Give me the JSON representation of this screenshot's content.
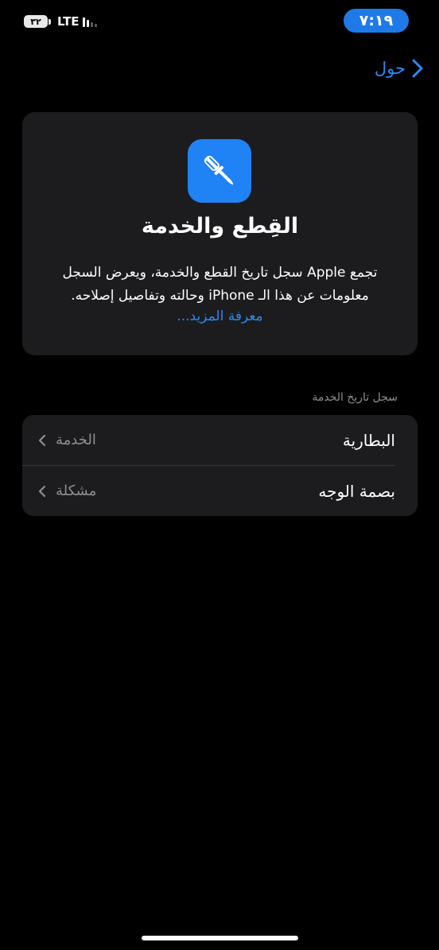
{
  "status_bar": {
    "time": "٧:١٩",
    "battery": "٣٢",
    "network": "LTE"
  },
  "nav": {
    "back_label": "حول",
    "back_icon": "chevron-right-icon"
  },
  "info_card": {
    "icon": "screwdriver-icon",
    "title": "القِطع والخدمة",
    "description_line1": "تجمع Apple سجل تاريخ القطع والخدمة، ويعرض السجل",
    "description_line2": "معلومات عن هذا الـ iPhone وحالته وتفاصيل إصلاحه.",
    "learn_more": "معرفة المزيد..."
  },
  "service_history": {
    "header": "سجل تاريخ الخدمة",
    "rows": [
      {
        "title": "البطارية",
        "detail": "الخدمة"
      },
      {
        "title": "بصمة الوجه",
        "detail": "مشكلة"
      }
    ]
  },
  "colors": {
    "accent": "#2b8af0",
    "card_bg": "#1c1c1e",
    "secondary_text": "#8e8e93",
    "icon_bg": "#1f82f5"
  }
}
